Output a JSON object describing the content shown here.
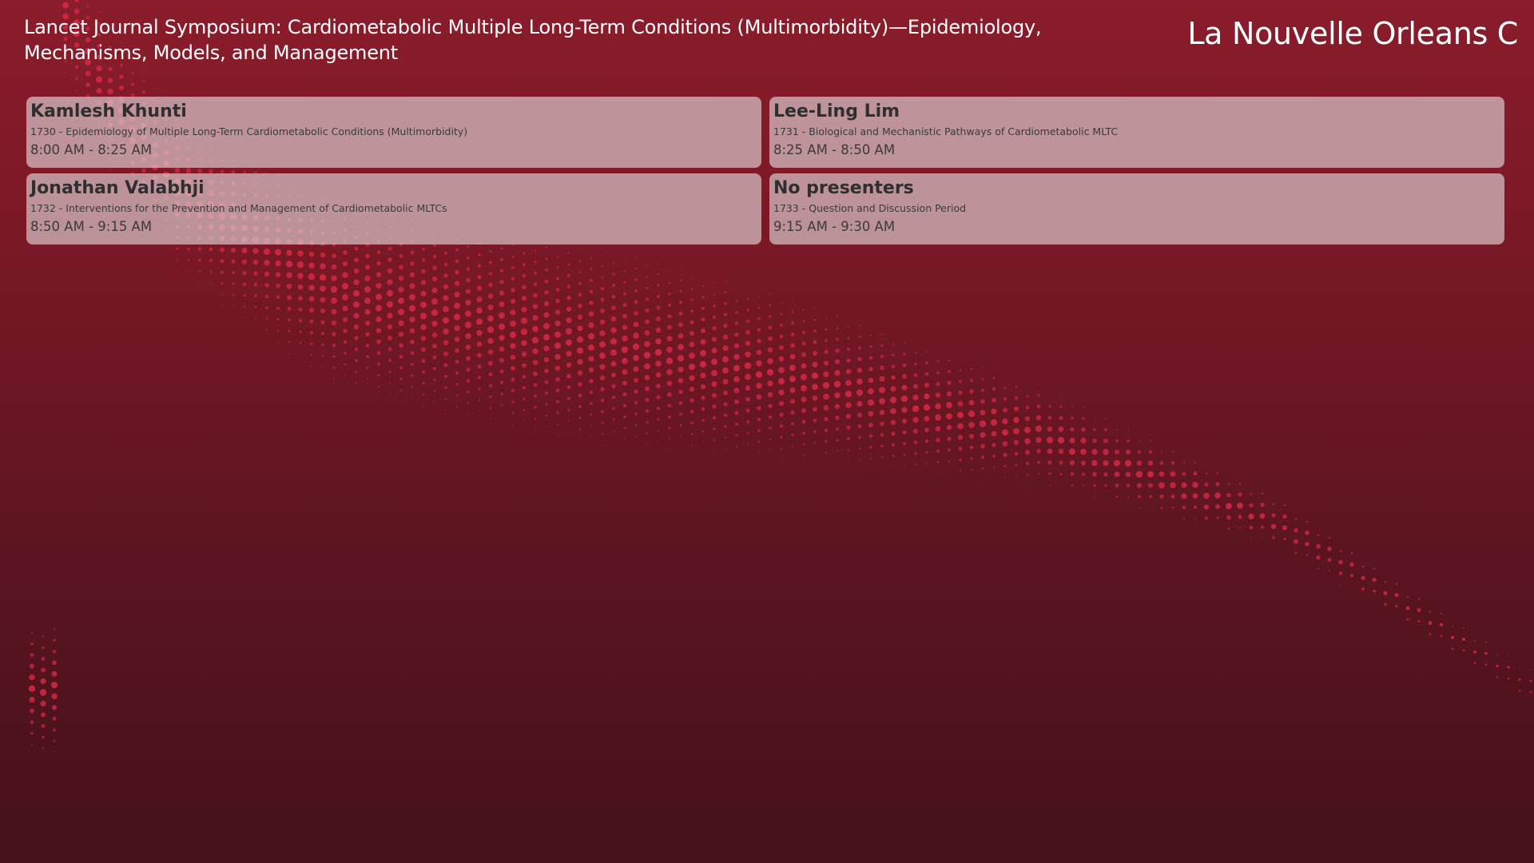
{
  "session": {
    "title": "Lancet Journal Symposium: Cardiometabolic Multiple Long-Term Conditions (Multimorbidity)—Epidemiology, Mechanisms, Models, and Management",
    "room": "La Nouvelle Orleans C"
  },
  "presentations": [
    {
      "presenter": "Kamlesh Khunti",
      "talk": "1730 - Epidemiology of Multiple Long-Term Cardiometabolic Conditions (Multimorbidity)",
      "time": "8:00 AM - 8:25 AM"
    },
    {
      "presenter": "Lee-Ling Lim",
      "talk": "1731 - Biological and Mechanistic Pathways of Cardiometabolic MLTC",
      "time": "8:25 AM - 8:50 AM"
    },
    {
      "presenter": "Jonathan Valabhji",
      "talk": "1732 - Interventions for the Prevention and Management of Cardiometabolic MLTCs",
      "time": "8:50 AM - 9:15 AM"
    },
    {
      "presenter": "No presenters",
      "talk": "1733 - Question and Discussion Period",
      "time": "9:15 AM - 9:30 AM"
    }
  ],
  "colors": {
    "background_top": "#8a1c2b",
    "background_bottom": "#45111a",
    "dot_pattern": "#e02a48",
    "card_background": "#dccdd0",
    "card_text": "#2f2f32"
  }
}
